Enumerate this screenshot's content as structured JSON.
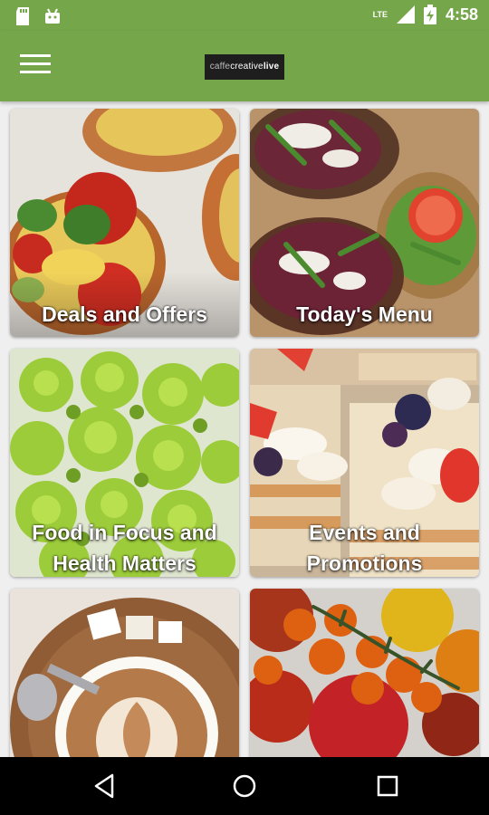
{
  "status_bar": {
    "time": "4:58",
    "network_label": "LTE",
    "icons": [
      "sd-card-icon",
      "android-icon",
      "signal-icon",
      "battery-charging-icon"
    ]
  },
  "app_bar": {
    "menu_icon": "hamburger-menu-icon",
    "logo": {
      "thin": "caffe",
      "regular": "creative",
      "bold": "live"
    }
  },
  "tiles": [
    {
      "label": "Deals and Offers",
      "image": "bruschetta-tomato-image"
    },
    {
      "label": "Today's Menu",
      "image": "salad-toasts-image"
    },
    {
      "label_line1": "Food in Focus and",
      "label_line2": "Health Matters",
      "image": "romanesco-image"
    },
    {
      "label_line1": "Events and",
      "label_line2": "Promotions",
      "image": "berry-cake-image"
    },
    {
      "label": "",
      "image": "cappuccino-image"
    },
    {
      "label": "",
      "image": "tomatoes-image"
    }
  ],
  "nav_bar": {
    "back_icon": "back-triangle-icon",
    "home_icon": "home-circle-icon",
    "recents_icon": "recents-square-icon"
  },
  "colors": {
    "brand": "#76a64a",
    "nav": "#000000"
  }
}
